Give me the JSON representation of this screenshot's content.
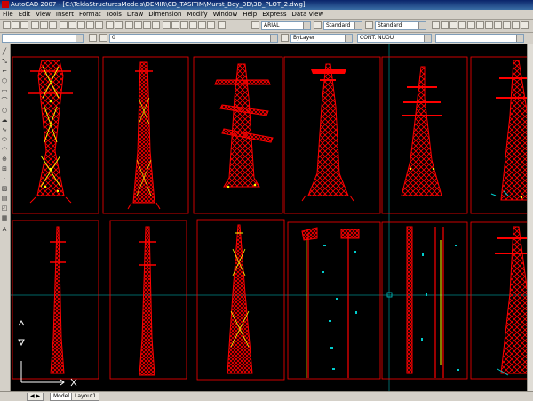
{
  "window": {
    "title": "AutoCAD 2007 - [C:\\TeklaStructuresModels\\DEMIR\\CD_TASITIM\\Murat_Bey_3D\\3D_PLOT_2.dwg]"
  },
  "menu": [
    "File",
    "Edit",
    "View",
    "Insert",
    "Format",
    "Tools",
    "Draw",
    "Dimension",
    "Modify",
    "Window",
    "Help",
    "Express",
    "Data View"
  ],
  "toolbar": {
    "text_style": "ARIAL",
    "dim_style": "Standard",
    "table_style": "Standard",
    "layer": "0",
    "color": "ByLayer",
    "linetype": "CONT. NUOU"
  },
  "tabs": [
    "Model",
    "Layout1"
  ],
  "colors": {
    "tower": "#ff0000",
    "highlight": "#ffff00",
    "frame": "#ff0000",
    "crosshair": "#006666"
  }
}
